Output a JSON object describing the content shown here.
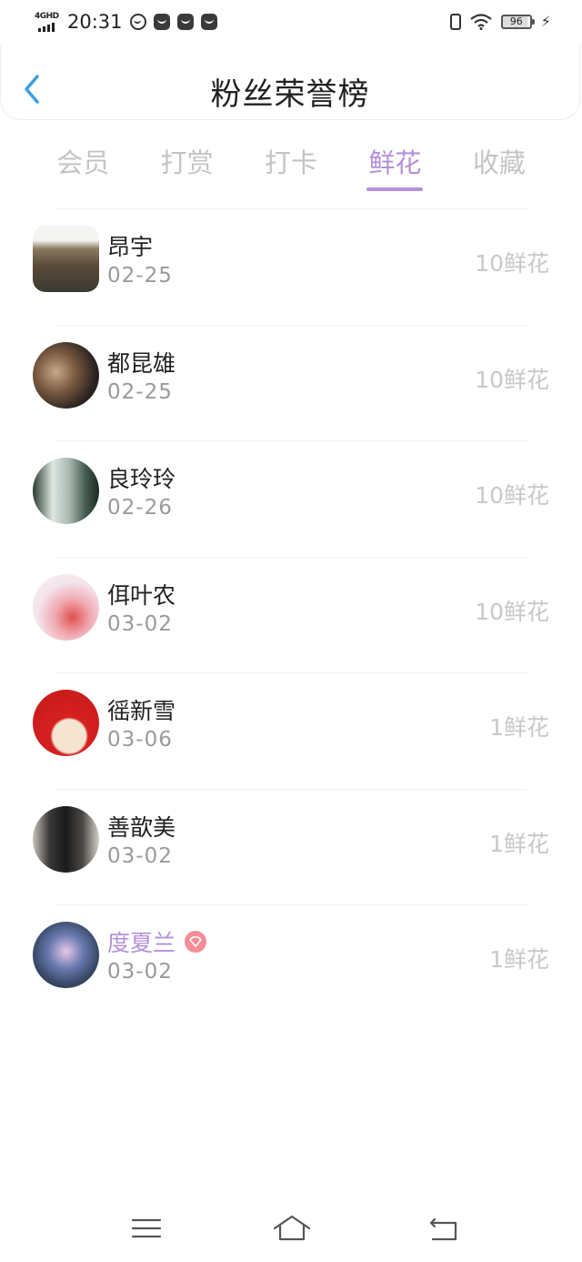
{
  "status_bar": {
    "network": "4GHD",
    "time": "20:31",
    "battery": "96",
    "icons": [
      "data-saver-icon",
      "vpn-icon",
      "shopping-bag-icon",
      "shopping-bag-icon",
      "vibrate-icon",
      "wifi-icon",
      "battery-icon",
      "charging-bolt-icon"
    ]
  },
  "header": {
    "title": "粉丝荣誉榜",
    "back_icon": "chevron-left-icon"
  },
  "tabs": [
    {
      "label": "会员",
      "active": false
    },
    {
      "label": "打赏",
      "active": false
    },
    {
      "label": "打卡",
      "active": false
    },
    {
      "label": "鲜花",
      "active": true
    },
    {
      "label": "收藏",
      "active": false
    }
  ],
  "fans": [
    {
      "name": "昂宇",
      "date": "02-25",
      "amount": "10鲜花"
    },
    {
      "name": "都昆雄",
      "date": "02-25",
      "amount": "10鲜花"
    },
    {
      "name": "良玲玲",
      "date": "02-26",
      "amount": "10鲜花"
    },
    {
      "name": "佴叶农",
      "date": "03-02",
      "amount": "10鲜花"
    },
    {
      "name": "徭新雪",
      "date": "03-06",
      "amount": "1鲜花"
    },
    {
      "name": "善歆美",
      "date": "03-02",
      "amount": "1鲜花"
    },
    {
      "name": "度夏兰",
      "date": "03-02",
      "amount": "1鲜花",
      "vip": true
    }
  ],
  "colors": {
    "accent": "#b48fdb",
    "back": "#3a9ee4",
    "vip_badge": "#f48d96"
  },
  "navbar": {
    "icons": [
      "menu-icon",
      "home-icon",
      "back-icon"
    ]
  }
}
